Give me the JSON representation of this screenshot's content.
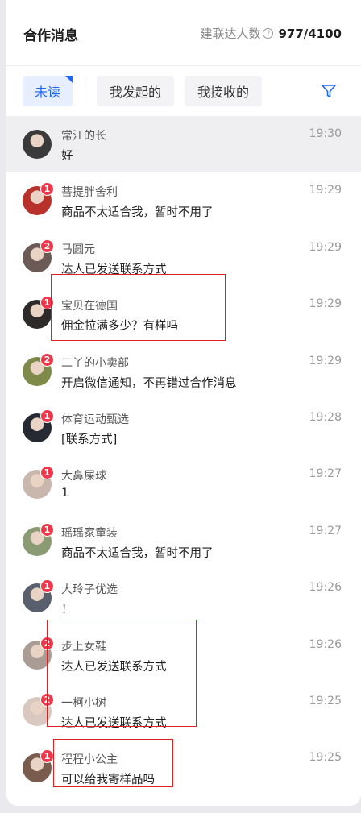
{
  "header": {
    "title": "合作消息",
    "stats_label": "建联达人数",
    "stats_icon": "?",
    "stats_value": "977/4100"
  },
  "tabs": [
    {
      "label": "未读",
      "active": true
    },
    {
      "label": "我发起的",
      "active": false
    },
    {
      "label": "我接收的",
      "active": false
    }
  ],
  "conversations": [
    {
      "name": "常江的长",
      "message": "好",
      "time": "19:30",
      "badge": "",
      "avatar_color": "#3a3a3a"
    },
    {
      "name": "菩提胖舍利",
      "message": "商品不太适合我，暂时不用了",
      "time": "19:29",
      "badge": "1",
      "avatar_color": "#b8322b"
    },
    {
      "name": "马圆元",
      "message": "达人已发送联系方式",
      "time": "19:29",
      "badge": "2",
      "avatar_color": "#6b5a55"
    },
    {
      "name": "宝贝在德国",
      "message": "佣金拉满多少？有样吗",
      "time": "19:29",
      "badge": "1",
      "avatar_color": "#2e2a2a"
    },
    {
      "name": "二丫的小卖部",
      "message": "开启微信通知，不再错过合作消息",
      "time": "19:29",
      "badge": "2",
      "avatar_color": "#7e8a4a"
    },
    {
      "name": "体育运动甄选",
      "message": "[联系方式]",
      "time": "19:28",
      "badge": "1",
      "avatar_color": "#262a33"
    },
    {
      "name": "大鼻屎球",
      "message": "1",
      "time": "19:27",
      "badge": "1",
      "avatar_color": "#c9b7ad"
    },
    {
      "name": "瑶瑶家童装",
      "message": "商品不太适合我，暂时不用了",
      "time": "19:27",
      "badge": "1",
      "avatar_color": "#8a9a72"
    },
    {
      "name": "大玲子优选",
      "message": "！",
      "time": "19:26",
      "badge": "1",
      "avatar_color": "#5a5f6e"
    },
    {
      "name": "步上女鞋",
      "message": "达人已发送联系方式",
      "time": "19:26",
      "badge": "2",
      "avatar_color": "#a89c94"
    },
    {
      "name": "一柯小树",
      "message": "达人已发送联系方式",
      "time": "19:25",
      "badge": "2",
      "avatar_color": "#d8c8c0"
    },
    {
      "name": "程程小公主",
      "message": "可以给我寄样品吗",
      "time": "19:25",
      "badge": "1",
      "avatar_color": "#7a5c4e"
    }
  ],
  "colors": {
    "accent": "#1a66ff",
    "badge": "#f0364a",
    "highlight": "#e02020"
  }
}
